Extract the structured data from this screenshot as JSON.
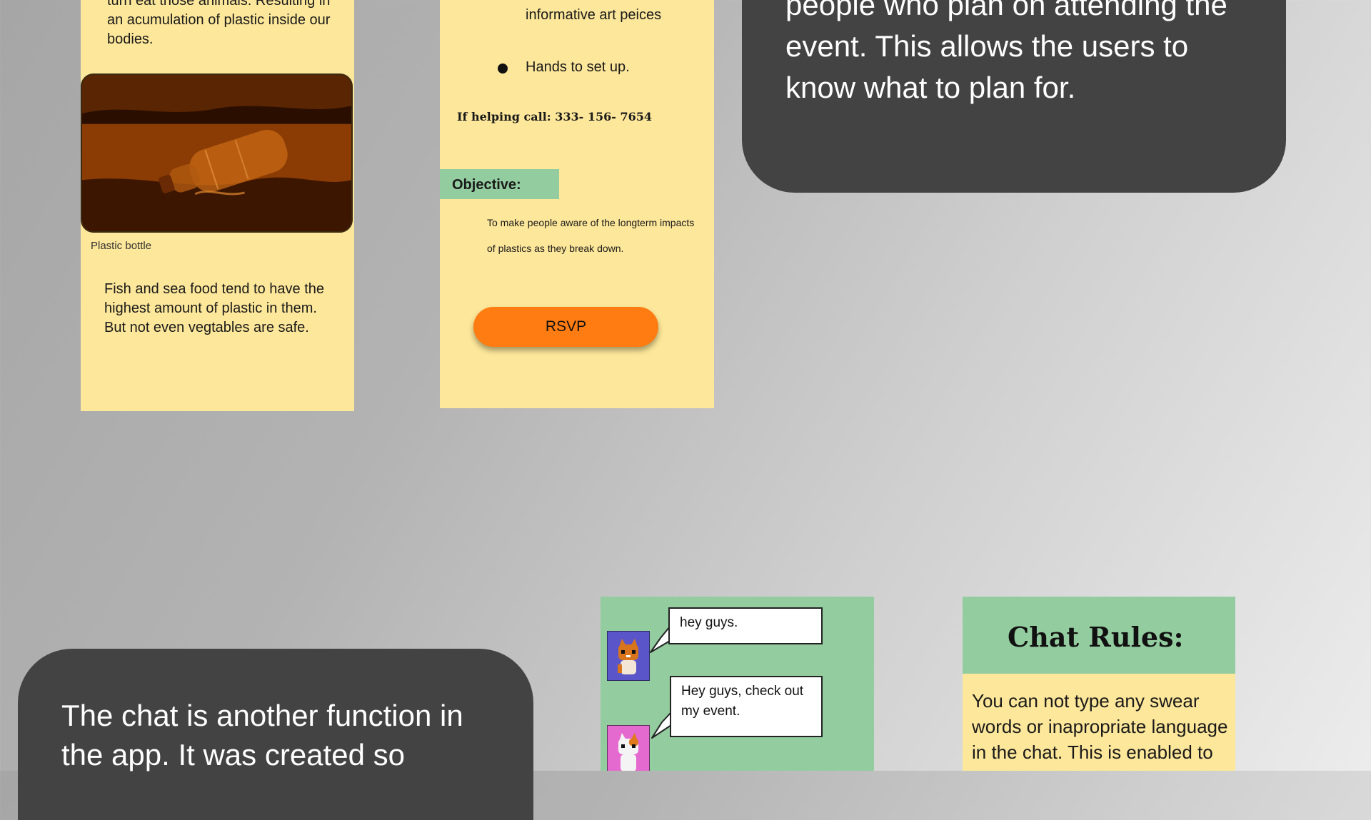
{
  "left_screen": {
    "intro_text": "turn eat those animals. Resulting in an acumulation of plastic inside our bodies.",
    "photo_caption": "Plastic bottle",
    "fish_text": "Fish and sea food tend to have the highest amount of plastic in them. But not even vegtables are safe."
  },
  "middle_screen": {
    "bullet_1": "informative art peices",
    "bullet_2": "Hands to set up.",
    "help_line": "If helping call: 333- 156- 7654",
    "objective_label": "Objective:",
    "objective_text": "To make people aware of the longterm impacts of plastics as they break down.",
    "rsvp_label": "RSVP"
  },
  "top_callout": {
    "text": "people who plan on attending the event. This allows the users to know what to plan for."
  },
  "bottom_callout": {
    "text": "The chat is another function in the app. It was created so"
  },
  "chat_screen": {
    "messages": [
      {
        "text": "hey guys."
      },
      {
        "text": "Hey guys, check out my event."
      }
    ]
  },
  "rules_screen": {
    "title": "Chat Rules:",
    "text": "You can not type any swear words or inapropriate language in the chat. This is enabled to keep"
  },
  "colors": {
    "panel_yellow": "#fde79a",
    "panel_green": "#93cc9f",
    "accent_orange": "#ff7c12",
    "callout_dark": "#434343"
  }
}
